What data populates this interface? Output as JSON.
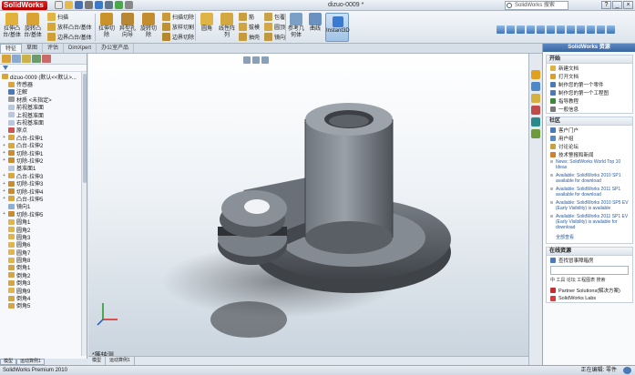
{
  "app": {
    "logo": "SolidWorks",
    "doc_title": "dizuo-0009 *",
    "search_placeholder": "SolidWorks 搜索"
  },
  "ribbon": {
    "group1": [
      "拉伸凸台/基体",
      "旋转凸台/基体"
    ],
    "group1_small": [
      "扫描",
      "放样凸台/基体",
      "边界凸台/基体"
    ],
    "group2": [
      "拉伸切除",
      "异型孔向导",
      "旋转切除"
    ],
    "group2_small": [
      "扫描切除",
      "放样切割",
      "边界切除"
    ],
    "group3": [
      "圆角",
      "线性阵列"
    ],
    "group3_small": [
      "筋",
      "拔模",
      "抽壳"
    ],
    "group3b_small": [
      "包覆",
      "圆顶",
      "镜向"
    ],
    "group4": [
      "参考几何体",
      "曲线"
    ],
    "instant3d": "Instant3D"
  },
  "cmd_tabs": [
    "特征",
    "草图",
    "评估",
    "DimXpert",
    "办公室产品"
  ],
  "tree": {
    "root": "dizuo-0009 (默认<<默认>...",
    "items": [
      {
        "label": "传感器",
        "icon": "sensor"
      },
      {
        "label": "注解",
        "icon": "annotation"
      },
      {
        "label": "材质 <未指定>",
        "icon": "material"
      },
      {
        "label": "前视基准面",
        "icon": "plane"
      },
      {
        "label": "上视基准面",
        "icon": "plane"
      },
      {
        "label": "右视基准面",
        "icon": "plane"
      },
      {
        "label": "原点",
        "icon": "origin"
      },
      {
        "label": "凸台-拉伸1",
        "icon": "boss"
      },
      {
        "label": "凸台-拉伸2",
        "icon": "boss"
      },
      {
        "label": "切除-拉伸1",
        "icon": "cut"
      },
      {
        "label": "切除-拉伸2",
        "icon": "cut"
      },
      {
        "label": "基准面1",
        "icon": "plane"
      },
      {
        "label": "凸台-拉伸3",
        "icon": "boss"
      },
      {
        "label": "切除-拉伸3",
        "icon": "cut"
      },
      {
        "label": "切除-拉伸4",
        "icon": "cut"
      },
      {
        "label": "凸台-拉伸5",
        "icon": "boss"
      },
      {
        "label": "镜向1",
        "icon": "mirror"
      },
      {
        "label": "切除-拉伸5",
        "icon": "cut"
      },
      {
        "label": "圆角1",
        "icon": "fillet"
      },
      {
        "label": "圆角2",
        "icon": "fillet"
      },
      {
        "label": "圆角3",
        "icon": "fillet"
      },
      {
        "label": "圆角6",
        "icon": "fillet"
      },
      {
        "label": "圆角7",
        "icon": "fillet"
      },
      {
        "label": "圆角8",
        "icon": "fillet"
      },
      {
        "label": "倒角1",
        "icon": "chamfer"
      },
      {
        "label": "倒角2",
        "icon": "chamfer"
      },
      {
        "label": "倒角3",
        "icon": "chamfer"
      },
      {
        "label": "圆角9",
        "icon": "fillet"
      },
      {
        "label": "倒角4",
        "icon": "chamfer"
      },
      {
        "label": "倒角5",
        "icon": "chamfer"
      }
    ]
  },
  "left_tabs": [
    "模型",
    "运动算例1"
  ],
  "viewport": {
    "view_label": "*等轴测",
    "tabs": [
      "模型",
      "运动算例1"
    ]
  },
  "taskpane": {
    "title": "SolidWorks 资源",
    "start": {
      "title": "开始",
      "items": [
        "新建文档",
        "打开文档",
        "制作您的第一个零件",
        "制作您的第一个工程图",
        "指导教程",
        "一般信息"
      ]
    },
    "community": {
      "title": "社区",
      "items": [
        "客户门户",
        "用户组",
        "讨论论坛",
        "技术警报和新闻"
      ],
      "news": [
        "News: SolidWorks World Top 10 Ideas",
        "Available: SolidWorks 2010 SP1 available for download",
        "Available: SolidWorks 2011 SP1 available for download",
        "Available: SolidWorks 2010 SP5 EV (Early Visibility) is available",
        "Available: SolidWorks 2011 SP1 EV (Early Visibility) is available for download"
      ],
      "more": "全部查看"
    },
    "online": {
      "title": "在线资源",
      "search_label": "查找冒事障箱房",
      "search_links": "中 工具 论坛 工程图表 搜索",
      "items": [
        "Partner Solutions(解决方案)",
        "SolidWorks Labs"
      ]
    }
  },
  "status": {
    "left": "SolidWorks Premium 2010",
    "right": "正在编辑: 零件"
  },
  "colors": {
    "accent": "#3a679f",
    "part_body": "#7e848c",
    "part_shadow": "#4a4e54"
  }
}
